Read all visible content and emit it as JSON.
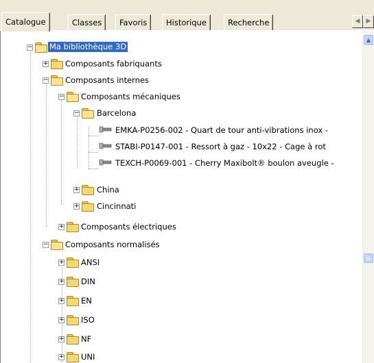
{
  "tabs": [
    "Catalogue",
    "Classes",
    "Favoris",
    "Historique",
    "Recherche"
  ],
  "active_tab": "Catalogue",
  "tree": {
    "root": "Ma bibliothèque 3D",
    "items": [
      {
        "label": "Composants fabriquants",
        "state": "collapsed"
      },
      {
        "label": "Composants internes",
        "state": "expanded"
      },
      {
        "label": "Composants mécaniques",
        "state": "expanded"
      },
      {
        "label": "Barcelona",
        "state": "expanded"
      },
      {
        "label": "EMKA-P0256-002  -  Quart de tour anti-vibrations inox -"
      },
      {
        "label": "STABI-P0147-001  -  Ressort à gaz - 10x22 - Cage à rot"
      },
      {
        "label": "TEXCH-P0069-001  -  Cherry Maxibolt® boulon aveugle -"
      },
      {
        "label": "China",
        "state": "collapsed"
      },
      {
        "label": "Cincinnati",
        "state": "collapsed"
      },
      {
        "label": "Composants électriques",
        "state": "collapsed"
      },
      {
        "label": "Composants normalisés",
        "state": "expanded"
      },
      {
        "label": "ANSI",
        "state": "collapsed"
      },
      {
        "label": "DIN",
        "state": "collapsed"
      },
      {
        "label": "EN",
        "state": "collapsed"
      },
      {
        "label": "ISO",
        "state": "collapsed"
      },
      {
        "label": "NF",
        "state": "collapsed"
      },
      {
        "label": "UNI",
        "state": "collapsed"
      }
    ]
  },
  "icons": {
    "folder": "folder-icon",
    "part": "part-icon",
    "scroll_left": "◀",
    "scroll_right": "▶",
    "scroll_up": "▲"
  },
  "colors": {
    "selection": "#316ac5",
    "folder": "#f5d874",
    "chrome": "#ece9d8"
  }
}
